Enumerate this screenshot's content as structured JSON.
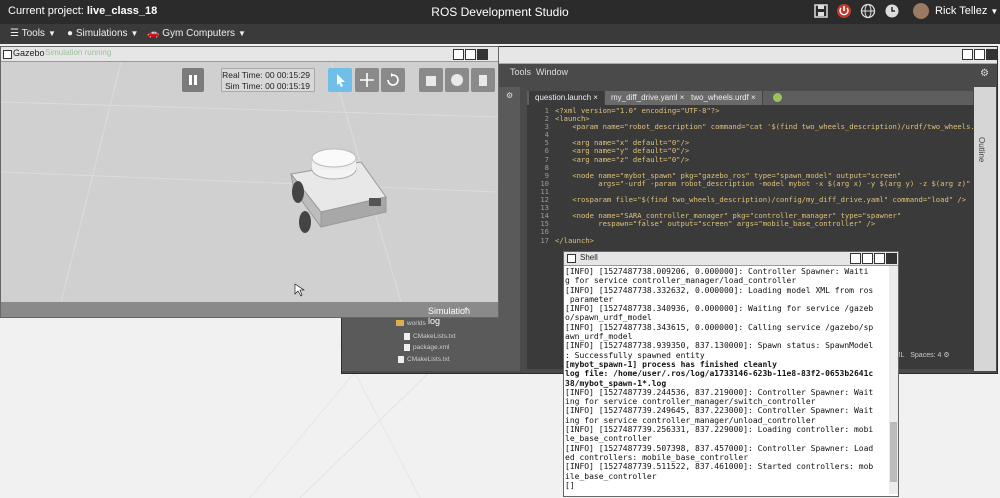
{
  "header": {
    "project_label": "Current project:",
    "project_name": "live_class_18",
    "app_title": "ROS Development Studio",
    "user_name": "Rick Tellez",
    "icons": [
      "save-icon",
      "power-icon",
      "globe-icon",
      "clock-icon"
    ]
  },
  "menubar": {
    "tools": "Tools",
    "simulations": "Simulations",
    "gym_computers": "Gym Computers"
  },
  "gazebo": {
    "title": "Gazebo",
    "subtitle": "Simulation running",
    "real_time": "Real Time: 00 00:15:29",
    "sim_time": "Sim Time: 00 00:15:19",
    "sim_log": "Simulation log"
  },
  "editor": {
    "menu": {
      "tools": "Tools",
      "window": "Window"
    },
    "tabs": [
      "question.launch",
      "my_diff_drive.yaml",
      "two_wheels.urdf"
    ],
    "outline_label": "Outline",
    "status": {
      "lang": "XML",
      "spaces": "Spaces: 4"
    },
    "tree": [
      "worlds",
      "CMakeLists.txt",
      "package.xml",
      "CMakeLists.txt"
    ],
    "line_numbers": [
      "1",
      "2",
      "3",
      "4",
      "5",
      "6",
      "7",
      "8",
      "9",
      "10",
      "11",
      "12",
      "13",
      "14",
      "15",
      "16",
      "17"
    ],
    "code_lines": [
      "<?xml version=\"1.0\" encoding=\"UTF-8\"?>",
      "<launch>",
      "    <param name=\"robot_description\" command=\"cat '$(find two_wheels_description)/urdf/two_wheels.urdf'\" />",
      "",
      "    <arg name=\"x\" default=\"0\"/>",
      "    <arg name=\"y\" default=\"0\"/>",
      "    <arg name=\"z\" default=\"0\"/>",
      "",
      "    <node name=\"mybot_spawn\" pkg=\"gazebo_ros\" type=\"spawn_model\" output=\"screen\"",
      "          args=\"-urdf -param robot_description -model mybot -x $(arg x) -y $(arg y) -z $(arg z)\" />",
      "",
      "    <rosparam file=\"$(find two_wheels_description)/config/my_diff_drive.yaml\" command=\"load\" />",
      "",
      "    <node name=\"SARA_controller_manager\" pkg=\"controller_manager\" type=\"spawner\"",
      "          respawn=\"false\" output=\"screen\" args=\"mobile_base_controller\" />",
      "",
      "</launch>"
    ]
  },
  "shell": {
    "title": "Shell",
    "lines": [
      "[INFO] [1527487738.009206, 0.000000]: Controller Spawner: Waiti",
      "g for service controller_manager/load_controller",
      "[INFO] [1527487738.332632, 0.000000]: Loading model XML from ros",
      " parameter",
      "[INFO] [1527487738.340936, 0.000000]: Waiting for service /gazeb",
      "o/spawn_urdf_model",
      "[INFO] [1527487738.343615, 0.000000]: Calling service /gazebo/sp",
      "awn_urdf_model",
      "[INFO] [1527487738.939350, 837.130000]: Spawn status: SpawnModel",
      ": Successfully spawned entity",
      "[mybot_spawn-1] process has finished cleanly",
      "log file: /home/user/.ros/log/a1733146-623b-11e8-83f2-0653b2641c",
      "38/mybot_spawn-1*.log",
      "[INFO] [1527487739.244536, 837.219000]: Controller Spawner: Wait",
      "ing for service controller_manager/switch_controller",
      "[INFO] [1527487739.249645, 837.223000]: Controller Spawner: Wait",
      "ing for service controller_manager/unload_controller",
      "[INFO] [1527487739.256331, 837.229000]: Loading controller: mobi",
      "le_base_controller",
      "[INFO] [1527487739.507398, 837.457000]: Controller Spawner: Load",
      "ed controllers: mobile_base_controller",
      "[INFO] [1527487739.511522, 837.461000]: Started controllers: mob",
      "ile_base_controller",
      "[]"
    ]
  }
}
